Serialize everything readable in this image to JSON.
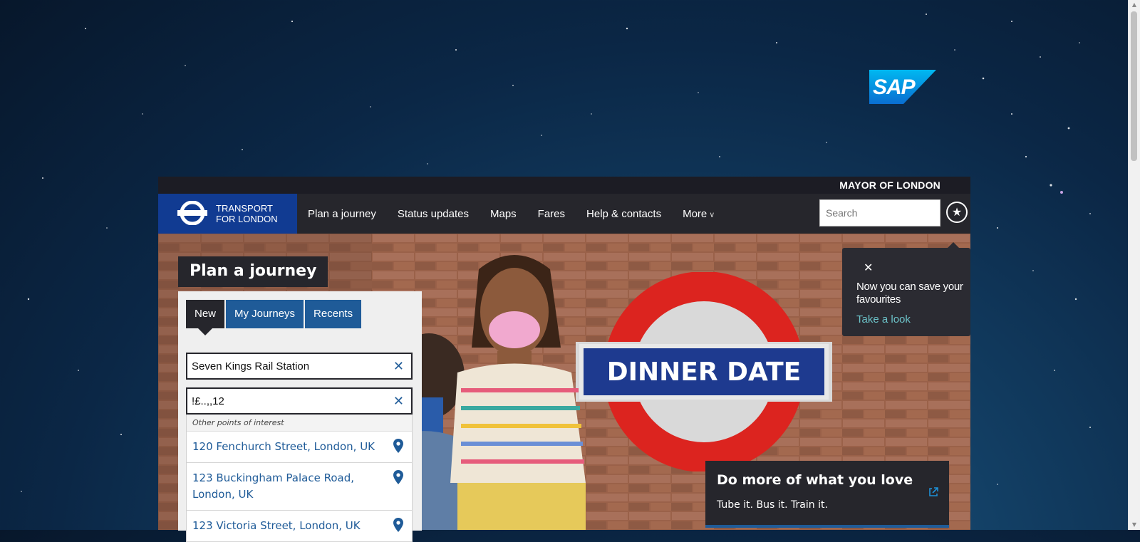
{
  "top_banner": {
    "advertiser_logo": "SAP"
  },
  "header": {
    "mayor_text": "MAYOR OF LONDON",
    "brand_line1": "TRANSPORT",
    "brand_line2": "FOR LONDON",
    "nav": [
      "Plan a journey",
      "Status updates",
      "Maps",
      "Fares",
      "Help & contacts",
      "More"
    ],
    "search_placeholder": "Search",
    "favourites_icon": "star-icon"
  },
  "hero": {
    "sign_text": "DINNER DATE"
  },
  "plan_journey": {
    "title": "Plan a journey",
    "tabs": [
      "New",
      "My Journeys",
      "Recents"
    ],
    "active_tab": "New",
    "from_value": "Seven Kings Rail Station",
    "to_value": "!£..,,12",
    "suggestions_heading": "Other points of interest",
    "suggestions": [
      "120 Fenchurch Street, London, UK",
      "123 Buckingham Palace Road, London, UK",
      "123 Victoria Street, London, UK"
    ]
  },
  "favourites_popup": {
    "close_icon": "close-icon",
    "message": "Now you can save your favourites",
    "link": "Take a look"
  },
  "promo": {
    "title": "Do more of what you love",
    "subtitle": "Tube it. Bus it. Train it.",
    "icon": "external-link-icon"
  },
  "colors": {
    "tfl_blue": "#113b92",
    "nav_dark": "#26262c",
    "tab_blue": "#1f5b98",
    "link_teal": "#6cc3c9",
    "roundel_red": "#dc241f"
  }
}
